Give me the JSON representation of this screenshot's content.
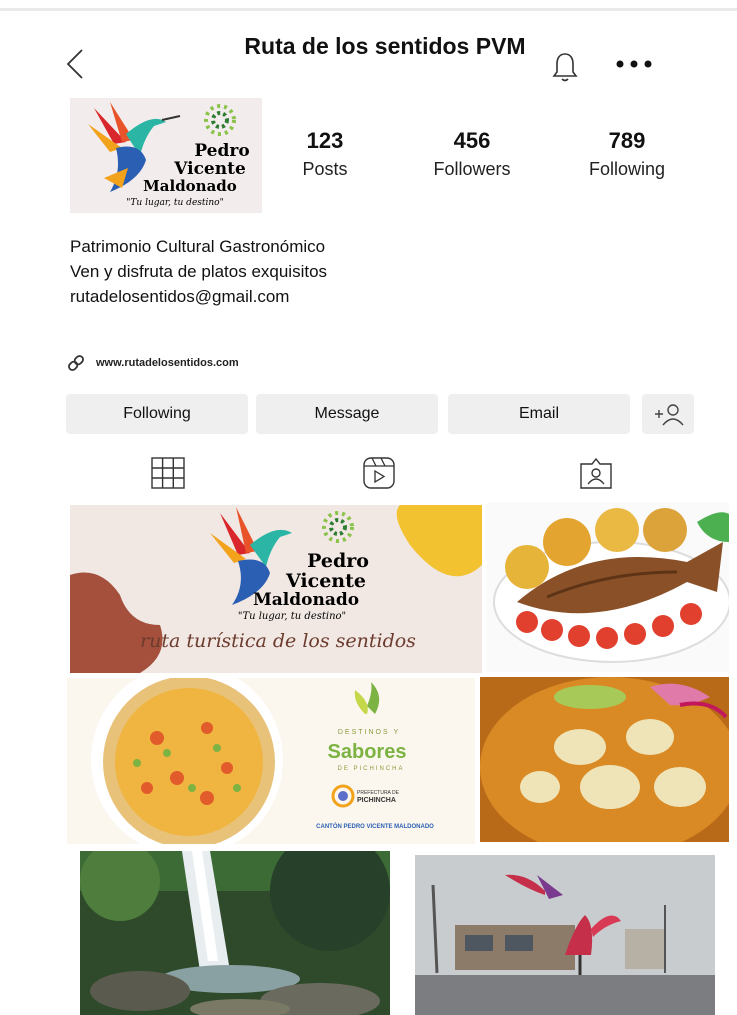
{
  "header": {
    "title": "Ruta de los sentidos PVM",
    "back_icon": "chevron-left-icon",
    "bell_icon": "bell-icon",
    "more_icon": "more-horizontal-icon"
  },
  "profile": {
    "avatar": {
      "line1": "Pedro",
      "line2": "Vicente",
      "line3": "Maldonado",
      "tagline": "\"Tu lugar, tu destino\""
    },
    "stats": [
      {
        "value": "123",
        "label": "Posts"
      },
      {
        "value": "456",
        "label": "Followers"
      },
      {
        "value": "789",
        "label": "Following"
      }
    ],
    "bio": [
      "Patrimonio Cultural Gastronómico",
      "Ven y disfruta de platos exquisitos",
      "rutadelosentidos@gmail.com"
    ],
    "website": "www.rutadelosentidos.com"
  },
  "actions": {
    "following": "Following",
    "message": "Message",
    "email": "Email"
  },
  "posts": {
    "post1": {
      "line1": "Pedro",
      "line2": "Vicente",
      "line3": "Maldonado",
      "tagline": "\"Tu lugar, tu destino\"",
      "caption": "ruta turística de los sentidos"
    },
    "post3": {
      "word1": "DESTINOS Y",
      "word2": "Sabores",
      "word3": "DE PICHINCHA",
      "badge1": "PREFECTURA DE",
      "badge2": "PICHINCHA",
      "footer": "CANTÓN PEDRO VICENTE MALDONADO"
    }
  },
  "colors": {
    "button_bg": "#efefef",
    "logo_blue": "#2b3f8e",
    "logo_red": "#c0392b"
  }
}
